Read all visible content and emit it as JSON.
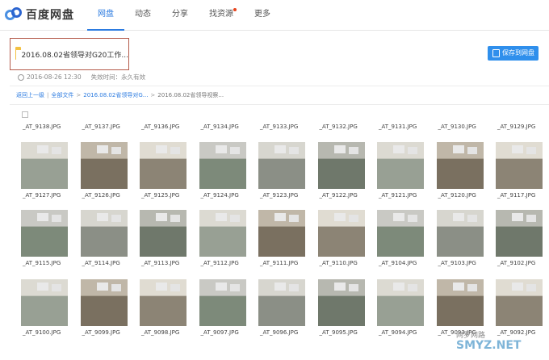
{
  "app": {
    "logo_text": "百度网盘",
    "accent": "#2c7be0"
  },
  "nav": {
    "tabs": [
      {
        "label": "网盘",
        "active": true
      },
      {
        "label": "动态",
        "active": false
      },
      {
        "label": "分享",
        "active": false
      },
      {
        "label": "找资源",
        "active": false,
        "badge": true
      },
      {
        "label": "更多",
        "active": false
      }
    ]
  },
  "share": {
    "title": "2016.08.02省领导对G20工作...",
    "date": "2016-08-26 12:30",
    "expiry": "失效时间：永久有效",
    "save_button": "保存到网盘"
  },
  "breadcrumb": {
    "items": [
      "返回上一级",
      "全部文件",
      "2016.08.02省领导对G...",
      "2016.08.02省领导视察..."
    ]
  },
  "files": {
    "rows": [
      {
        "labels": [
          "_AT_9138.JPG",
          "_AT_9137.JPG",
          "_AT_9136.JPG",
          "_AT_9134.JPG",
          "_AT_9133.JPG",
          "_AT_9132.JPG",
          "_AT_9131.JPG",
          "_AT_9130.JPG",
          "_AT_9129.JPG"
        ],
        "thumbs": false
      },
      {
        "labels": [
          "_AT_9127.JPG",
          "_AT_9126.JPG",
          "_AT_9125.JPG",
          "_AT_9124.JPG",
          "_AT_9123.JPG",
          "_AT_9122.JPG",
          "_AT_9121.JPG",
          "_AT_9120.JPG",
          "_AT_9117.JPG"
        ],
        "thumbs": true
      },
      {
        "labels": [
          "_AT_9115.JPG",
          "_AT_9114.JPG",
          "_AT_9113.JPG",
          "_AT_9112.JPG",
          "_AT_9111.JPG",
          "_AT_9110.JPG",
          "_AT_9104.JPG",
          "_AT_9103.JPG",
          "_AT_9102.JPG"
        ],
        "thumbs": true
      },
      {
        "labels": [
          "_AT_9100.JPG",
          "_AT_9099.JPG",
          "_AT_9098.JPG",
          "_AT_9097.JPG",
          "_AT_9096.JPG",
          "_AT_9095.JPG",
          "_AT_9094.JPG",
          "_AT_9093.JPG",
          "_AT_9092.JPG"
        ],
        "thumbs": true
      }
    ]
  },
  "watermark": {
    "line1": "网罗网路",
    "line2": "SMYZ.NET"
  }
}
